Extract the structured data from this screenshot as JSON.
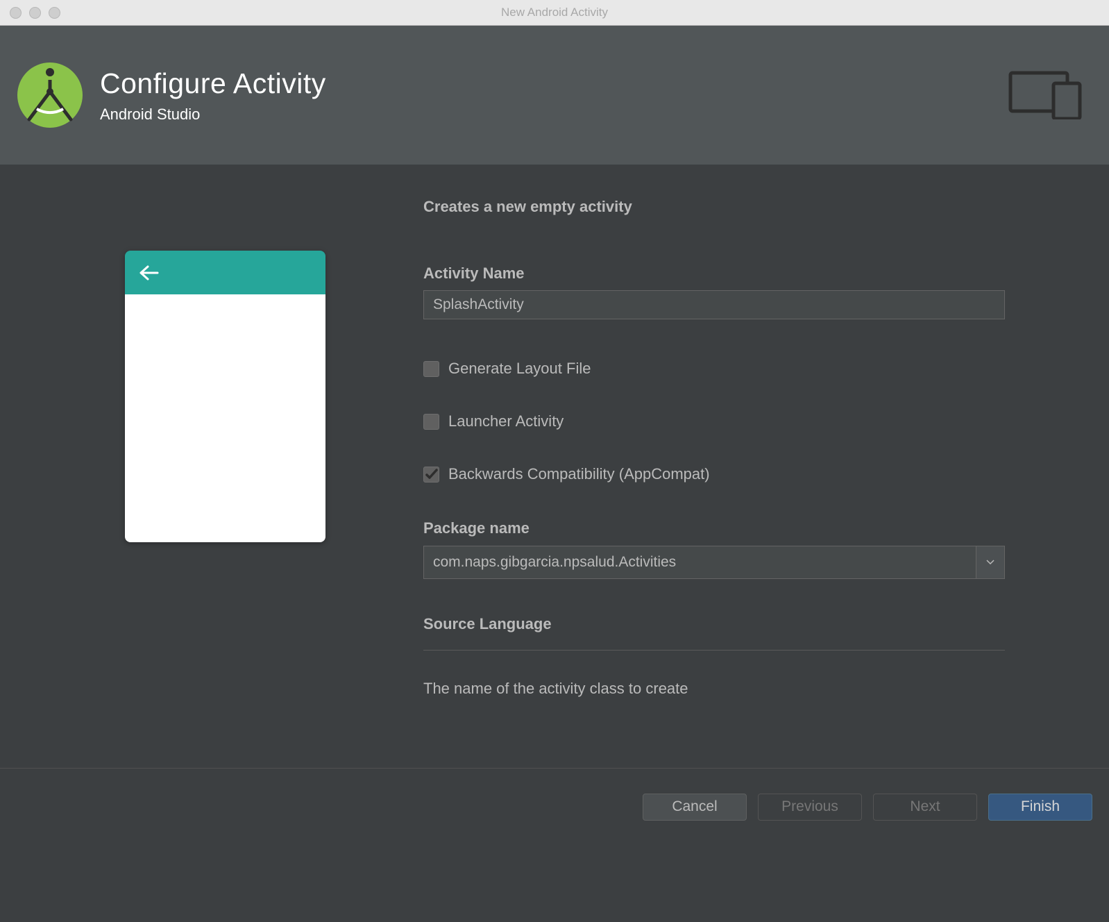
{
  "window": {
    "title": "New Android Activity"
  },
  "header": {
    "title": "Configure Activity",
    "subtitle": "Android Studio"
  },
  "intro": "Creates a new empty activity",
  "form": {
    "activityName": {
      "label": "Activity Name",
      "value": "SplashActivity"
    },
    "generateLayout": {
      "label": "Generate Layout File",
      "checked": false
    },
    "launcherActivity": {
      "label": "Launcher Activity",
      "checked": false
    },
    "backwardsCompat": {
      "label": "Backwards Compatibility (AppCompat)",
      "checked": true
    },
    "packageName": {
      "label": "Package name",
      "value": "com.naps.gibgarcia.npsalud.Activities"
    },
    "sourceLanguage": {
      "label": "Source Language"
    },
    "help": "The name of the activity class to create"
  },
  "footer": {
    "cancel": "Cancel",
    "previous": "Previous",
    "next": "Next",
    "finish": "Finish"
  }
}
